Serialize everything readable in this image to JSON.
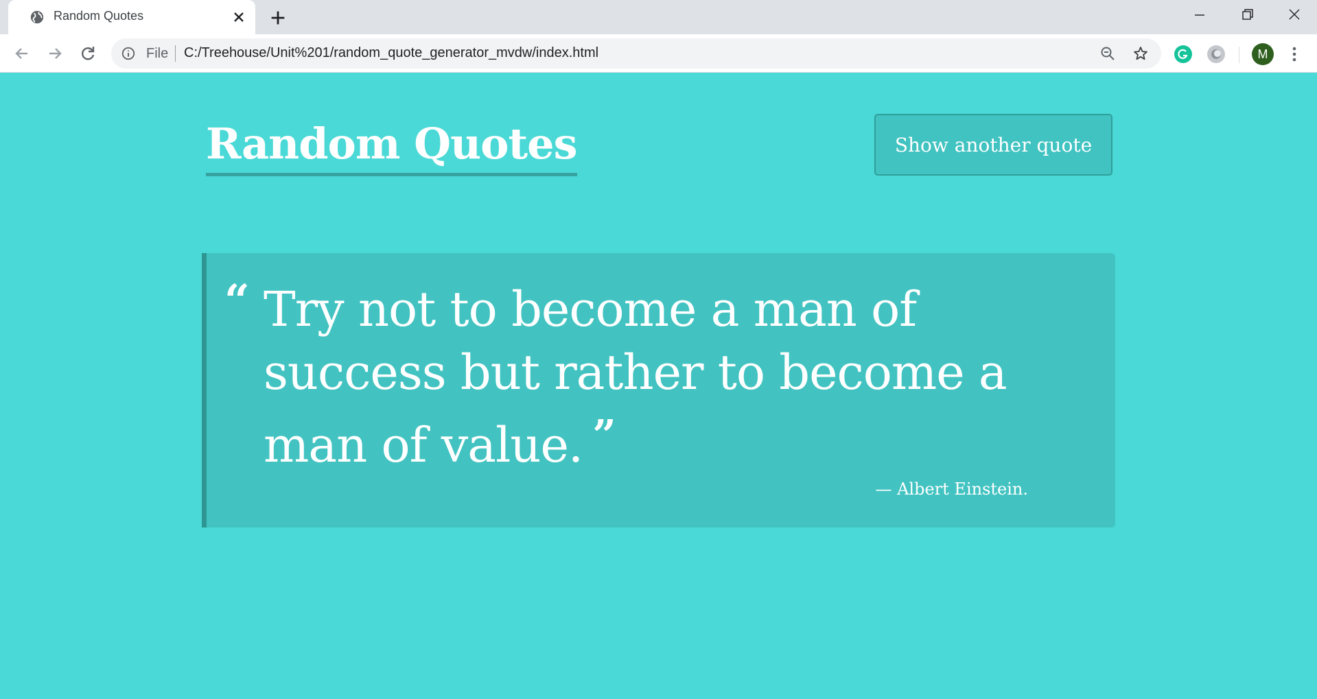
{
  "browser": {
    "tab_title": "Random Quotes",
    "address_scheme_label": "File",
    "address_url": "C:/Treehouse/Unit%201/random_quote_generator_mvdw/index.html",
    "profile_initial": "M",
    "icons": [
      "globe-icon",
      "close-icon",
      "plus-icon",
      "minimize-icon",
      "restore-icon",
      "window-close-icon",
      "back-icon",
      "forward-icon",
      "reload-icon",
      "info-icon",
      "zoom-out-icon",
      "star-icon",
      "grammarly-icon",
      "extension-icon",
      "menu-icon"
    ]
  },
  "page": {
    "title": "Random Quotes",
    "button_label": "Show another quote",
    "quote": {
      "open_mark": "“",
      "text": "Try not to become a man of success but rather to become a man of value.",
      "close_mark": "”",
      "attribution": "— Albert Einstein."
    }
  },
  "colors": {
    "background": "#4ad9d6",
    "quote_box": "#42c3c1",
    "accent_border": "#2e9592",
    "text": "#ffffff"
  }
}
